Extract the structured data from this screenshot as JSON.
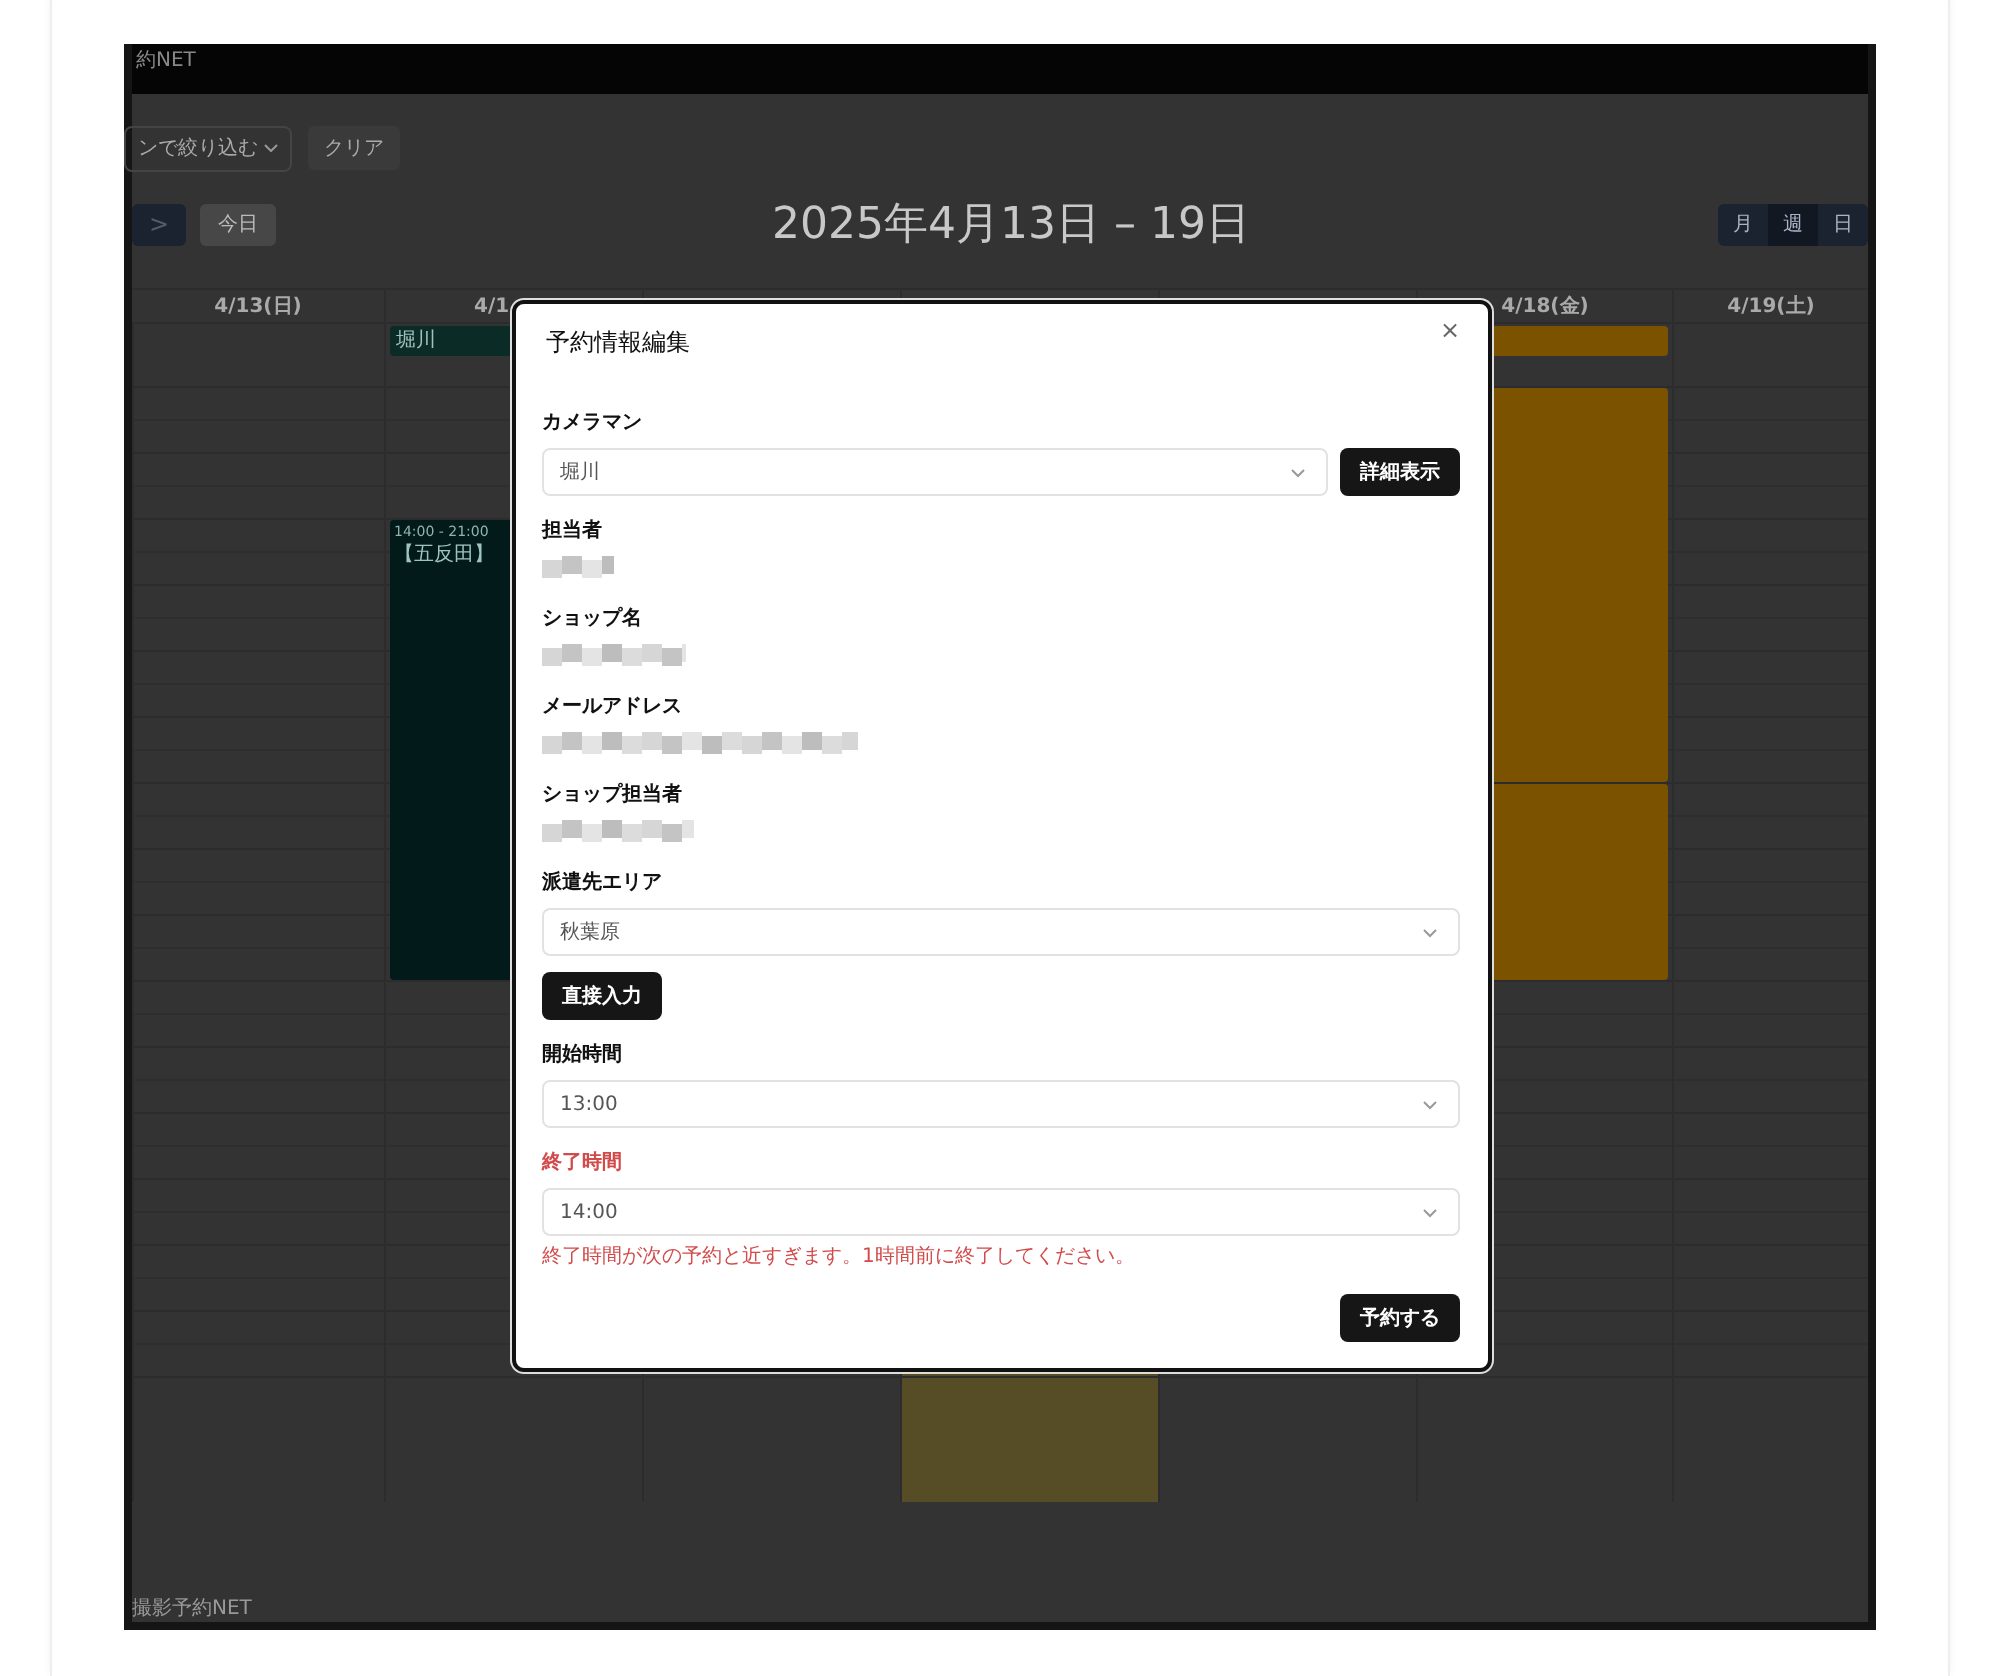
{
  "app": {
    "brand": "約NET",
    "footer": "撮影予約NET"
  },
  "toolbar": {
    "filter": "ンで絞り込む",
    "clear": "クリア"
  },
  "nav": {
    "next": ">",
    "today": "今日",
    "title": "2025年4月13日 – 19日",
    "views": [
      {
        "label": "月",
        "selected": false
      },
      {
        "label": "週",
        "selected": true
      },
      {
        "label": "日",
        "selected": false
      }
    ]
  },
  "calendar": {
    "days": [
      {
        "label": "4/13(日)",
        "today": false
      },
      {
        "label": "4/1",
        "today": false
      },
      {
        "today": false
      },
      {
        "today": true
      },
      {
        "today": false
      },
      {
        "label": "4/18(金)",
        "today": false
      },
      {
        "label": "4/19(土)",
        "today": false
      }
    ],
    "events": [
      {
        "kind": "allday",
        "color": "#0b2b27",
        "label": "堀川"
      },
      {
        "kind": "timed",
        "color": "#021a1a",
        "time": "14:00 - 21:00",
        "label": "【五反田】"
      },
      {
        "kind": "allday",
        "color": "#7a5200"
      },
      {
        "kind": "timed",
        "color": "#7a5200"
      },
      {
        "kind": "timed",
        "color": "#7a5200"
      }
    ]
  },
  "modal": {
    "title": "予約情報編集",
    "close": "×",
    "fields": [
      {
        "kind": "select",
        "label": "カメラマン",
        "value": "堀川",
        "button": "詳細表示"
      },
      {
        "kind": "redacted",
        "label": "担当者"
      },
      {
        "kind": "redacted",
        "label": "ショップ名"
      },
      {
        "kind": "redacted",
        "label": "メールアドレス"
      },
      {
        "kind": "redacted",
        "label": "ショップ担当者"
      },
      {
        "kind": "select",
        "label": "派遣先エリア",
        "value": "秋葉原"
      },
      {
        "kind": "button",
        "label": "直接入力"
      },
      {
        "kind": "select",
        "label": "開始時間",
        "value": "13:00"
      },
      {
        "kind": "select",
        "label": "終了時間",
        "value": "14:00",
        "error": "終了時間が次の予約と近すぎます。1時間前に終了してください。"
      }
    ],
    "submit": "予約する"
  }
}
